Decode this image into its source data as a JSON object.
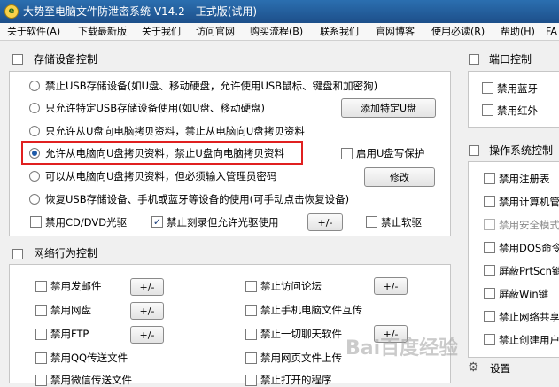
{
  "window": {
    "title": "大势至电脑文件防泄密系统 V14.2 - 正式版(试用)"
  },
  "menu": [
    "关于软件(A)",
    "下载最新版",
    "关于我们",
    "访问官网",
    "购买流程(B)",
    "联系我们",
    "官网博客",
    "使用必读(R)",
    "帮助(H)",
    "FA"
  ],
  "storage": {
    "title": "存储设备控制",
    "options": [
      "禁止USB存储设备(如U盘、移动硬盘，允许使用USB鼠标、键盘和加密狗)",
      "只允许特定USB存储设备使用(如U盘、移动硬盘)",
      "只允许从U盘向电脑拷贝资料，禁止从电脑向U盘拷贝资料",
      "允许从电脑向U盘拷贝资料，禁止U盘向电脑拷贝资料",
      "可以从电脑向U盘拷贝资料，但必须输入管理员密码",
      "恢复USB存储设备、手机或蓝牙等设备的使用(可手动点击恢复设备)"
    ],
    "selected_index": 3,
    "add_button": "添加特定U盘",
    "write_protect": "启用U盘写保护",
    "modify_button": "修改",
    "cd_dvd": "禁用CD/DVD光驱",
    "burn": "禁止刻录但允许光驱使用",
    "pm_button": "+/-",
    "floppy": "禁止软驱"
  },
  "network": {
    "title": "网络行为控制",
    "left": [
      "禁用发邮件",
      "禁用网盘",
      "禁用FTP",
      "禁用QQ传送文件",
      "禁用微信传送文件"
    ],
    "left_has_button": [
      true,
      true,
      true,
      false,
      false
    ],
    "right": [
      "禁止访问论坛",
      "禁止手机电脑文件互传",
      "禁止一切聊天软件",
      "禁用网页文件上传",
      "禁止打开的程序"
    ],
    "right_has_button": [
      true,
      false,
      true,
      false,
      false
    ],
    "pm_button": "+/-"
  },
  "port": {
    "title": "端口控制",
    "items": [
      "禁用蓝牙",
      "禁用红外"
    ]
  },
  "os": {
    "title": "操作系统控制",
    "items": [
      "禁用注册表",
      "禁用计算机管",
      "禁用安全模式",
      "禁用DOS命令",
      "屏蔽PrtScn键",
      "屏蔽Win键",
      "禁止网络共享",
      "禁止创建用户"
    ],
    "disabled_index": 2
  },
  "settings": {
    "label": "设置"
  },
  "watermark": "Bai百度经验"
}
